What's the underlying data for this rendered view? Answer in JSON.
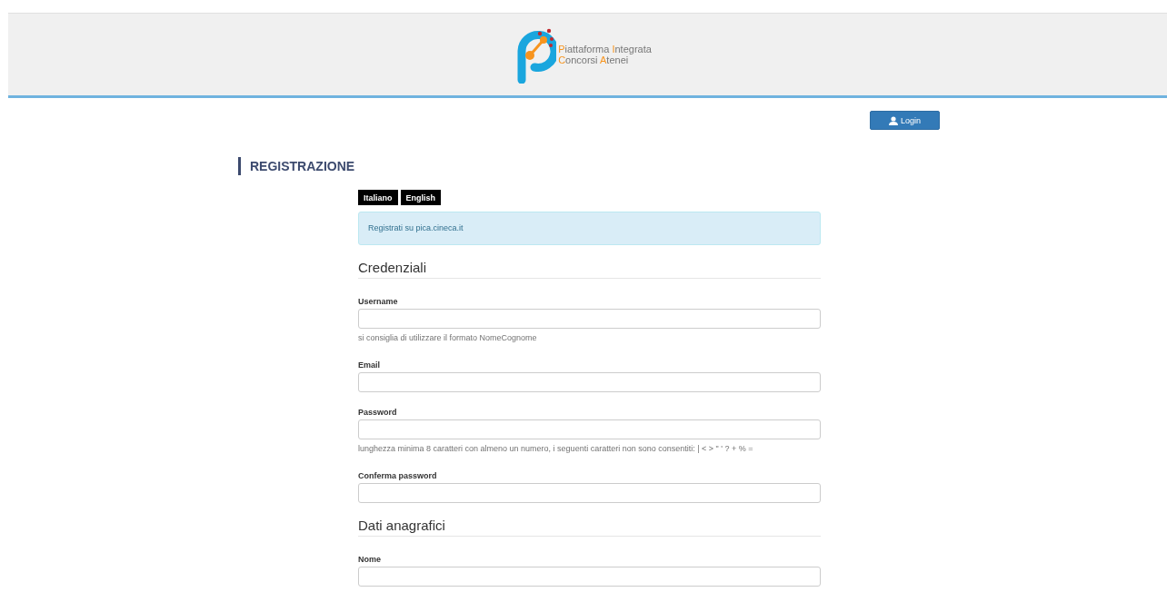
{
  "header": {
    "logo_lines": [
      "Piattaforma Integrata",
      "Concorsi Atenei"
    ]
  },
  "login_button": "Login",
  "title": "REGISTRAZIONE",
  "languages": [
    "Italiano",
    "English"
  ],
  "info": "Registrati su pica.cineca.it",
  "sections": [
    {
      "title": "Credenziali",
      "fields": [
        {
          "label": "Username",
          "hint": "si consiglia di utilizzare il formato NomeCognome"
        },
        {
          "label": "Email"
        },
        {
          "label": "Password",
          "hint": "lunghezza minima 8 caratteri con almeno un numero, i seguenti caratteri non sono consentiti: | < > \" ' ? + % ="
        },
        {
          "label": "Conferma password"
        }
      ]
    },
    {
      "title": "Dati anagrafici",
      "fields": [
        {
          "label": "Nome"
        }
      ]
    }
  ]
}
